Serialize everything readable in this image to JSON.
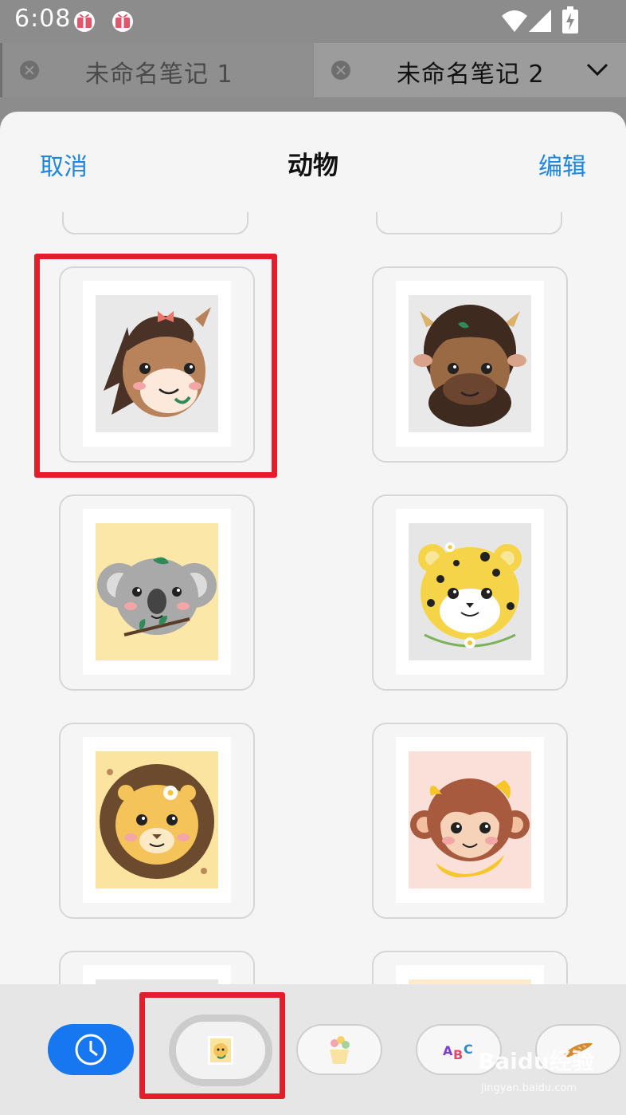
{
  "status_bar": {
    "time": "6:08"
  },
  "tabs": [
    {
      "label": "未命名笔记 1",
      "active": false
    },
    {
      "label": "未命名笔记 2",
      "active": true
    }
  ],
  "sheet": {
    "cancel_label": "取消",
    "title": "动物",
    "edit_label": "编辑"
  },
  "stickers": [
    {
      "icon": "horse-sticker-icon",
      "background": "#e9e9e9"
    },
    {
      "icon": "buffalo-sticker-icon",
      "background": "#e9e9e9"
    },
    {
      "icon": "koala-sticker-icon",
      "background": "#fbe7a8"
    },
    {
      "icon": "leopard-sticker-icon",
      "background": "#e6e6e6"
    },
    {
      "icon": "lion-sticker-icon",
      "background": "#fbe3a0"
    },
    {
      "icon": "monkey-sticker-icon",
      "background": "#fbe0da"
    }
  ],
  "categories": [
    {
      "icon": "clock-icon",
      "selected": false
    },
    {
      "icon": "animal-category-icon",
      "selected": true
    },
    {
      "icon": "flower-pot-category-icon",
      "selected": false
    },
    {
      "icon": "abc-category-icon",
      "selected": false
    },
    {
      "icon": "bread-category-icon",
      "selected": false
    }
  ],
  "colors": {
    "accent": "#1f86e0",
    "selected_pill": "#1677f0",
    "highlight": "#e41d2a"
  },
  "watermark": {
    "logo": "Baidu经验",
    "url": "jingyan.baidu.com"
  }
}
